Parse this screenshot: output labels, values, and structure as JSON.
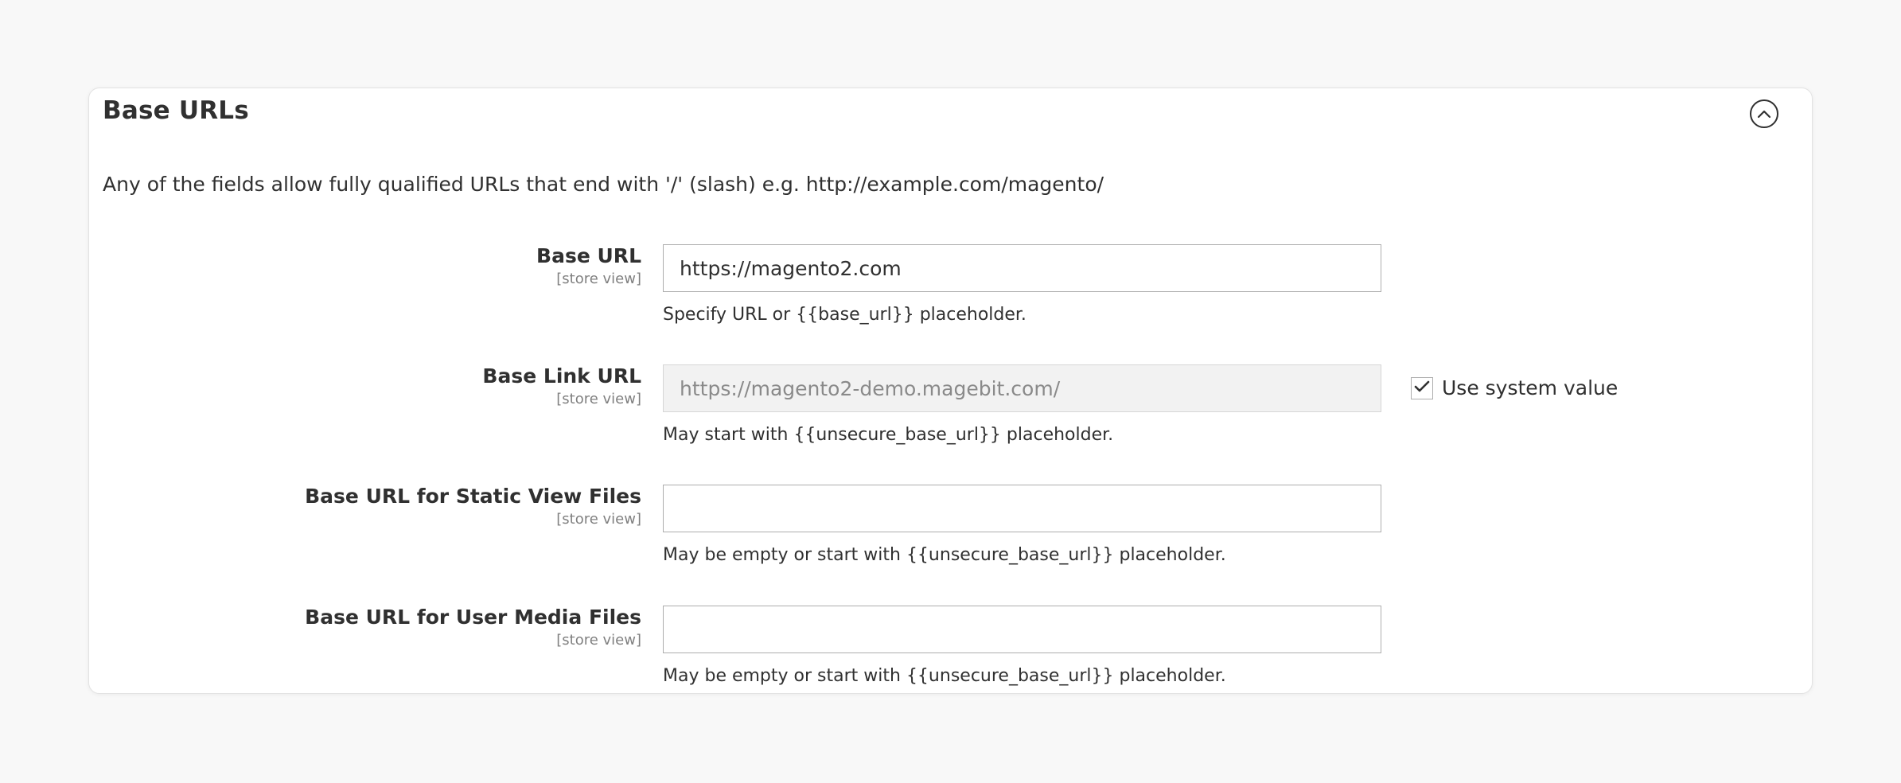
{
  "section": {
    "title": "Base URLs",
    "description": "Any of the fields allow fully qualified URLs that end with '/' (slash) e.g. http://example.com/magento/"
  },
  "fields": [
    {
      "label": "Base URL",
      "scope": "[store view]",
      "value": "https://magento2.com",
      "placeholder": "",
      "note": "Specify URL or {{base_url}} placeholder.",
      "disabled": false
    },
    {
      "label": "Base Link URL",
      "scope": "[store view]",
      "value": "https://magento2-demo.magebit.com/",
      "placeholder": "",
      "note": "May start with {{unsecure_base_url}} placeholder.",
      "disabled": true,
      "use_system_value_label": "Use system value",
      "use_system_value_checked": true
    },
    {
      "label": "Base URL for Static View Files",
      "scope": "[store view]",
      "value": "",
      "placeholder": "",
      "note": "May be empty or start with {{unsecure_base_url}} placeholder.",
      "disabled": false
    },
    {
      "label": "Base URL for User Media Files",
      "scope": "[store view]",
      "value": "",
      "placeholder": "",
      "note": "May be empty or start with {{unsecure_base_url}} placeholder.",
      "disabled": false
    }
  ],
  "icons": {
    "collapse": "chevron-up-circle-icon",
    "checkmark": "check-icon"
  }
}
